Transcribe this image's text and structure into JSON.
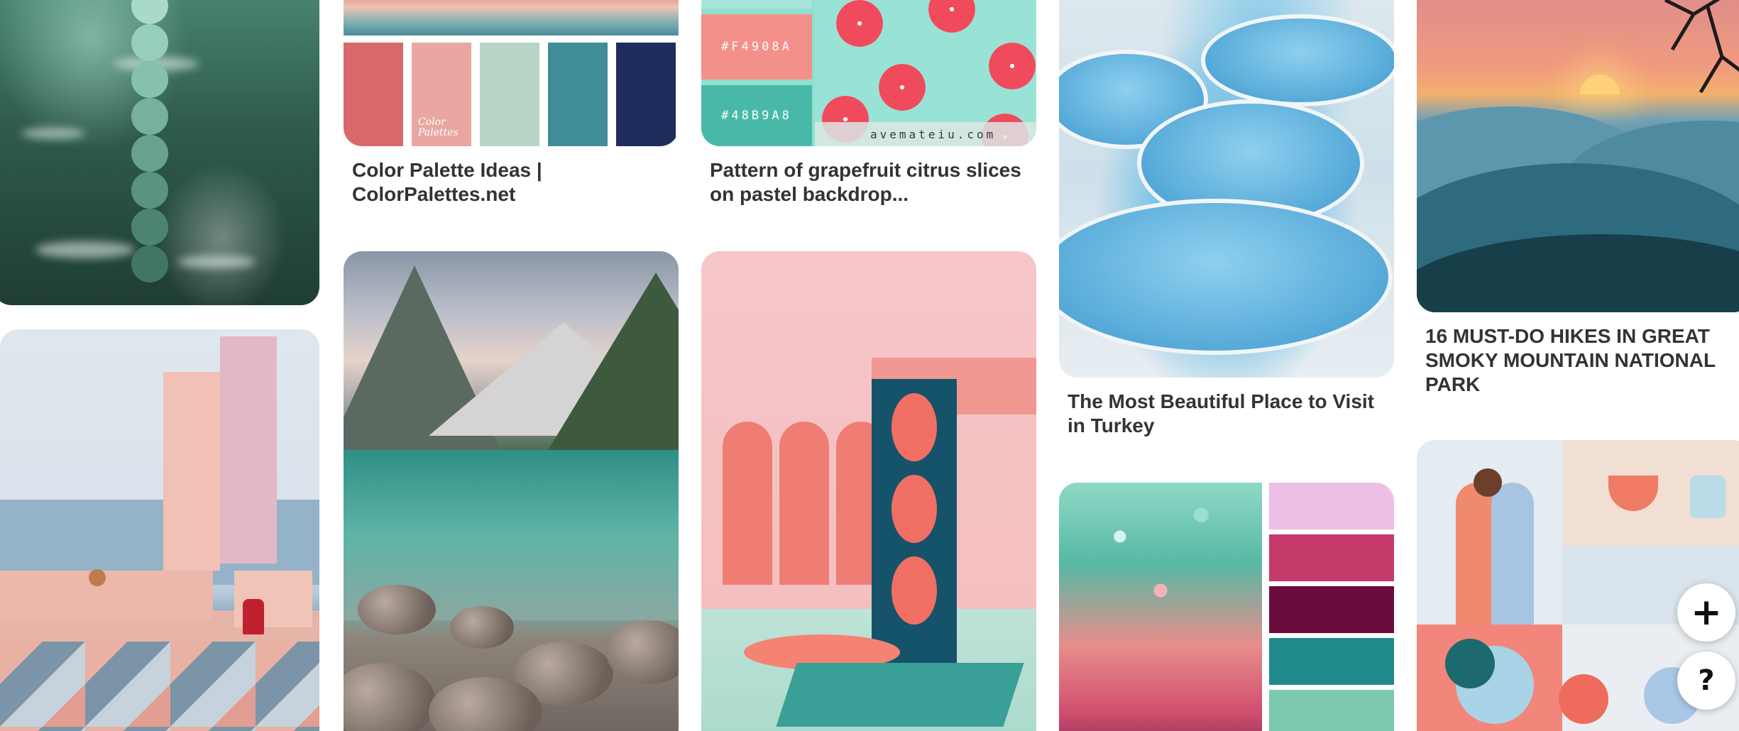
{
  "pins": {
    "palette": {
      "title": "Color Palette Ideas | ColorPalettes.net",
      "brand_text": "Color\nPalettes",
      "swatches": [
        "#d9686b",
        "#e8a7a1",
        "#b8d4c6",
        "#3f8d99",
        "#1f2d5c"
      ]
    },
    "grapefruit": {
      "title": "Pattern of grapefruit citrus slices on pastel backdrop...",
      "hex_labels": [
        "#F4908A",
        "#48B9A8"
      ],
      "site_caption": "avemateiu.com"
    },
    "turkey": {
      "title": "The Most Beautiful Place to Visit in Turkey"
    },
    "smoky": {
      "title": "16 MUST-DO HIKES IN GREAT SMOKY MOUNTAIN NATIONAL PARK"
    },
    "ocean": {
      "dot_colors": [
        "#a8d9cb",
        "#96cdbd",
        "#86c0ae",
        "#77b19e",
        "#68a28e",
        "#5a937f",
        "#4d8470",
        "#417662"
      ]
    },
    "glitter": {
      "swatches": [
        "#eebfe6",
        "#c53a6b",
        "#6a0d3e",
        "#208a8c",
        "#7dc9ad"
      ]
    }
  },
  "buttons": {
    "add_icon": "+",
    "help_icon": "?"
  },
  "colors": {
    "title_text": "#333333",
    "background": "#ffffff"
  }
}
